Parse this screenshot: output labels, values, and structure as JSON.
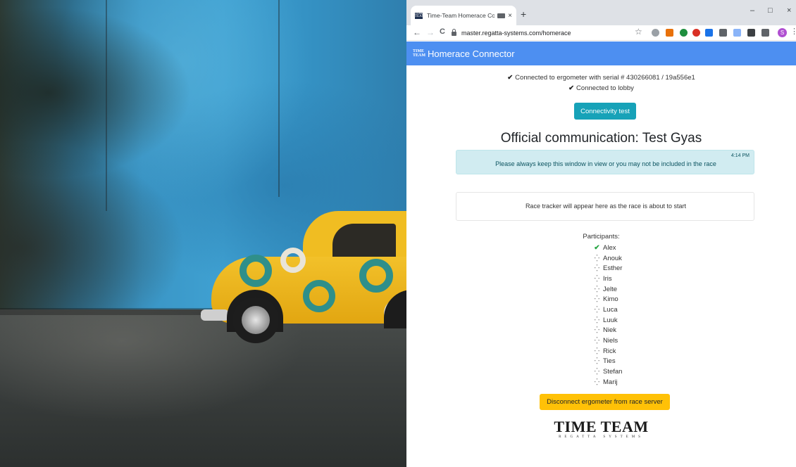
{
  "browser": {
    "tab_title": "Time-Team Homerace Conn",
    "favicon_text": "TIME TEAM",
    "new_tab": "+",
    "tab_close": "×",
    "url": "master.regatta-systems.com/homerace",
    "profile_initial": "S",
    "window_controls": {
      "minimize": "–",
      "maximize": "□",
      "close": "×"
    },
    "nav": {
      "back": "←",
      "forward": "→",
      "reload": "C",
      "star": "☆",
      "menu": "⋮"
    }
  },
  "app": {
    "logo_text": "TIME TEAM",
    "name": "Homerace Connector",
    "accent_color": "#4d8ff1"
  },
  "status": {
    "ergometer": "Connected to ergometer with serial # 430266081 / 19a556e1",
    "lobby": "Connected to lobby",
    "check_glyph": "✔"
  },
  "buttons": {
    "connectivity_test": "Connectivity test",
    "disconnect": "Disconnect ergometer from race server"
  },
  "headline": "Official communication: Test Gyas",
  "alert": {
    "message": "Please always keep this window in view or you may not be included in the race",
    "time": "4:14 PM"
  },
  "tracker_message": "Race tracker will appear here as the race is about to start",
  "participants": {
    "label": "Participants:",
    "items": [
      {
        "name": "Alex",
        "status": "connected",
        "icon": "✔"
      },
      {
        "name": "Anouk",
        "status": "waiting",
        "icon": "⁛"
      },
      {
        "name": "Esther",
        "status": "waiting",
        "icon": "⁛"
      },
      {
        "name": "Iris",
        "status": "waiting",
        "icon": "⁛"
      },
      {
        "name": "Jelte",
        "status": "waiting",
        "icon": "⁛"
      },
      {
        "name": "Kimo",
        "status": "waiting",
        "icon": "⁛"
      },
      {
        "name": "Luca",
        "status": "waiting",
        "icon": "⁛"
      },
      {
        "name": "Luuk",
        "status": "waiting",
        "icon": "⁛"
      },
      {
        "name": "Niek",
        "status": "waiting",
        "icon": "⁛"
      },
      {
        "name": "Niels",
        "status": "waiting",
        "icon": "⁛"
      },
      {
        "name": "Rick",
        "status": "waiting",
        "icon": "⁛"
      },
      {
        "name": "Ties",
        "status": "waiting",
        "icon": "⁛"
      },
      {
        "name": "Stefan",
        "status": "waiting",
        "icon": "⁛"
      },
      {
        "name": "Marij",
        "status": "waiting",
        "icon": "⁛"
      }
    ]
  },
  "footer": {
    "logo_main": "TIME TEAM",
    "logo_sub": "REGATTA SYSTEMS"
  }
}
